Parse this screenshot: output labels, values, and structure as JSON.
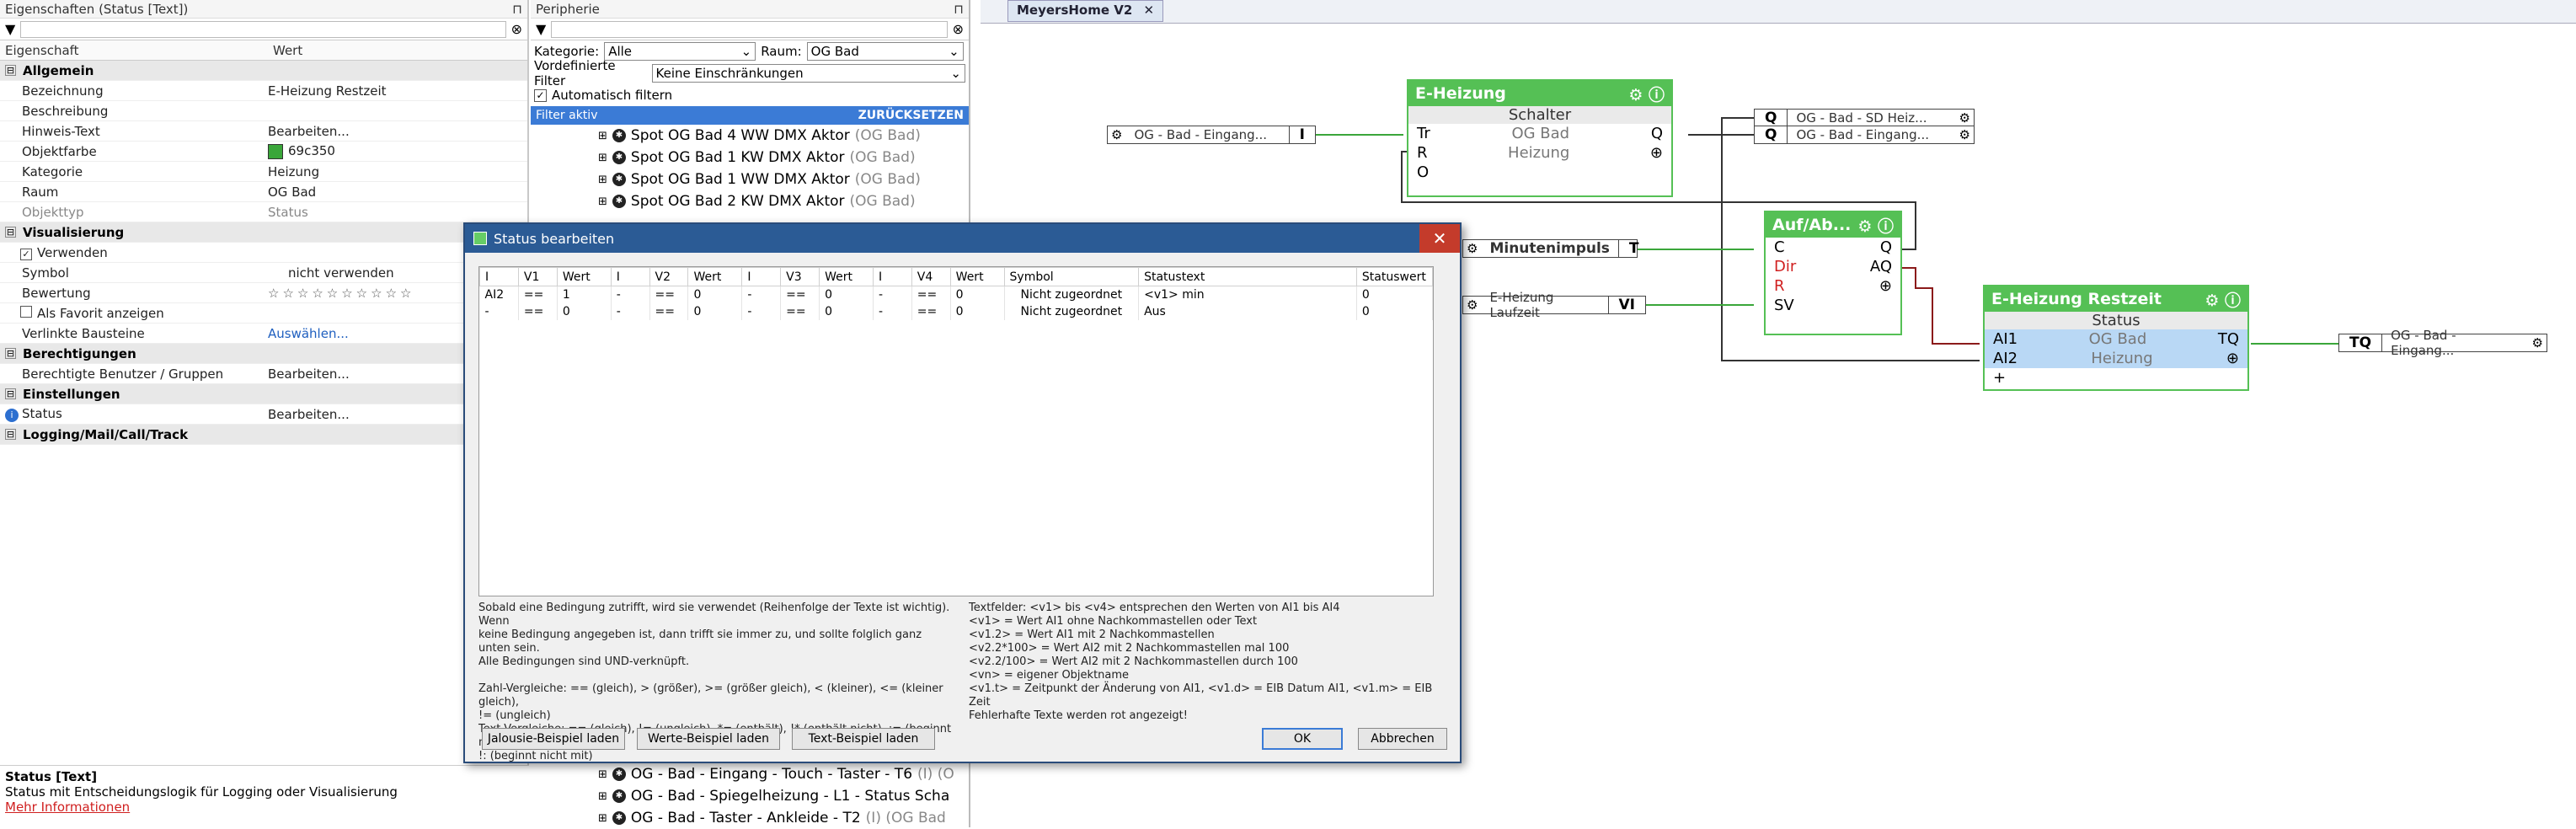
{
  "props": {
    "title": "Eigenschaften (Status [Text])",
    "col_key": "Eigenschaft",
    "col_val": "Wert",
    "rows": [
      {
        "type": "group",
        "label": "Allgemein"
      },
      {
        "key": "Bezeichnung",
        "val": "E-Heizung Restzeit"
      },
      {
        "key": "Beschreibung",
        "val": ""
      },
      {
        "key": "Hinweis-Text",
        "val": "Bearbeiten..."
      },
      {
        "key": "Objektfarbe",
        "val": "69c350",
        "colour": "#3aa63a"
      },
      {
        "key": "Kategorie",
        "val": "Heizung"
      },
      {
        "key": "Raum",
        "val": "OG Bad"
      },
      {
        "key": "Objekttyp",
        "val": "Status"
      },
      {
        "type": "group",
        "label": "Visualisierung"
      },
      {
        "key": "Verwenden",
        "val": "",
        "check": true
      },
      {
        "key": "Symbol",
        "val": "nicht verwenden"
      },
      {
        "key": "Bewertung",
        "val": "☆☆☆☆☆☆☆☆☆☆",
        "stars": true
      },
      {
        "key": "Als Favorit anzeigen",
        "val": "",
        "check": false
      },
      {
        "key": "Verlinkte Bausteine",
        "val": "Auswählen...",
        "link": true
      },
      {
        "type": "group",
        "label": "Berechtigungen"
      },
      {
        "key": "Berechtigte Benutzer / Gruppen",
        "val": "Bearbeiten..."
      },
      {
        "type": "group",
        "label": "Einstellungen"
      },
      {
        "key": "Status",
        "val": "Bearbeiten...",
        "info": true
      },
      {
        "type": "group",
        "label": "Logging/Mail/Call/Track"
      }
    ],
    "foot_title": "Status [Text]",
    "foot_desc": "Status mit Entscheidungslogik für Logging oder Visualisierung",
    "foot_link": "Mehr Informationen"
  },
  "peri": {
    "title": "Peripherie",
    "kategorie_label": "Kategorie:",
    "kategorie_value": "Alle",
    "raum_label": "Raum:",
    "raum_value": "OG Bad",
    "vfilter_label": "Vordefinierte Filter",
    "vfilter_value": "Keine Einschränkungen",
    "auto_filter": "Automatisch filtern",
    "filter_active": "Filter aktiv",
    "reset": "ZURÜCKSETZEN",
    "items_top": [
      {
        "name": "Spot OG Bad 4 WW DMX Aktor",
        "room": "(OG Bad)"
      },
      {
        "name": "Spot OG Bad 1 KW DMX Aktor",
        "room": "(OG Bad)"
      },
      {
        "name": "Spot OG Bad 1 WW DMX Aktor",
        "room": "(OG Bad)"
      },
      {
        "name": "Spot OG Bad 2 KW DMX Aktor",
        "room": "(OG Bad)"
      }
    ],
    "items_bottom": [
      {
        "name": "OG - Bad - Eingang - Touch - Taster - T6",
        "room": "(I) (O"
      },
      {
        "name": "OG - Bad - Spiegelheizung - L1 - Status Scha",
        "room": ""
      },
      {
        "name": "OG - Bad - Taster - Ankleide - T2",
        "room": "(I) (OG Bad"
      }
    ]
  },
  "designer": {
    "tab": "MeyersHome V2",
    "ext_in1": {
      "label": "OG - Bad - Eingang...",
      "sig": "I"
    },
    "ext_out1": {
      "sig": "Q",
      "label": "OG - Bad - SD Heiz..."
    },
    "ext_out2": {
      "sig": "Q",
      "label": "OG - Bad - Eingang..."
    },
    "ext_min": {
      "label": "Minutenimpuls",
      "sig": "T"
    },
    "ext_lauf": {
      "label": "E-Heizung Laufzeit",
      "sig": "VI"
    },
    "ext_out3": {
      "sig": "TQ",
      "label": "OG - Bad - Eingang..."
    },
    "blk1": {
      "title": "E-Heizung",
      "sub": "Schalter",
      "tr": "Tr",
      "room": "OG Bad",
      "q": "Q",
      "r": "R",
      "cat": "Heizung",
      "o": "O"
    },
    "blk2": {
      "title": "Auf/Ab...",
      "c": "C",
      "q": "Q",
      "dir": "Dir",
      "aq": "AQ",
      "r": "R",
      "sv": "SV"
    },
    "blk3": {
      "title": "E-Heizung Restzeit",
      "sub": "Status",
      "ai1": "AI1",
      "room": "OG Bad",
      "tq": "TQ",
      "ai2": "AI2",
      "cat": "Heizung"
    }
  },
  "dialog": {
    "title": "Status bearbeiten",
    "headers": [
      "I",
      "V1",
      "Wert",
      "I",
      "V2",
      "Wert",
      "I",
      "V3",
      "Wert",
      "I",
      "V4",
      "Wert",
      "Symbol",
      "Statustext",
      "Statuswert"
    ],
    "rows": [
      [
        "AI2",
        "==",
        "1",
        "-",
        "==",
        "0",
        "-",
        "==",
        "0",
        "-",
        "==",
        "0",
        "Nicht zugeordnet",
        "<v1> min",
        "0"
      ],
      [
        "-",
        "==",
        "0",
        "-",
        "==",
        "0",
        "-",
        "==",
        "0",
        "-",
        "==",
        "0",
        "Nicht zugeordnet",
        "Aus",
        "0"
      ]
    ],
    "help_left": "Sobald eine Bedingung zutrifft, wird sie verwendet (Reihenfolge der Texte ist wichtig). Wenn\nkeine Bedingung angegeben ist, dann trifft sie immer zu, und sollte folglich ganz unten sein.\nAlle Bedingungen sind UND-verknüpft.\n\nZahl-Vergleiche: == (gleich), > (größer), >= (größer gleich), < (kleiner), <= (kleiner gleich),\n!= (ungleich)\nText-Vergleiche: == (gleich), != (ungleich), *= (enthält), !* (enthält nicht), := (beginnt mit),\n!: (beginnt nicht mit)",
    "help_right": "Textfelder: <v1> bis <v4> entsprechen den Werten von AI1 bis AI4\n<v1> = Wert AI1 ohne Nachkommastellen oder Text\n<v1.2> = Wert AI1 mit 2 Nachkommastellen\n<v2.2*100> = Wert AI2 mit 2 Nachkommastellen mal 100\n<v2.2/100> = Wert AI2 mit 2 Nachkommastellen durch 100\n<vn> = eigener Objektname\n<v1.t> = Zeitpunkt der Änderung von AI1, <v1.d> = EIB Datum AI1, <v1.m> = EIB Zeit\nFehlerhafte Texte werden rot angezeigt!",
    "btn_jal": "Jalousie-Beispiel laden",
    "btn_werte": "Werte-Beispiel laden",
    "btn_text": "Text-Beispiel laden",
    "btn_ok": "OK",
    "btn_cancel": "Abbrechen"
  }
}
